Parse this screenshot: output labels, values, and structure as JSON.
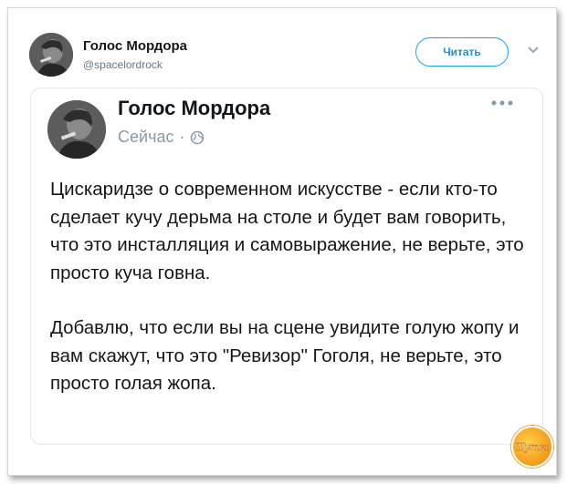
{
  "header": {
    "author_name": "Голос Мордора",
    "author_handle": "@spacelordrock",
    "follow_label": "Читать"
  },
  "card": {
    "author_name": "Голос Мордора",
    "time": "Сейчас",
    "separator": "·",
    "paragraphs": [
      "Цискаридзе о современном искусстве - если кто-то сделает кучу дерьма на столе и будет вам говорить, что это инсталляция и самовыражение, не верьте, это просто куча говна.",
      "Добавлю, что если вы на сцене увидите голую жопу и вам скажут, что это \"Ревизор\" Гоголя, не верьте, это просто голая жопа."
    ]
  },
  "watermark": {
    "label": "Шутка"
  },
  "colors": {
    "accent": "#1da1f2",
    "text": "#14171a",
    "muted": "#8899a6",
    "border": "#e1e8ed"
  }
}
